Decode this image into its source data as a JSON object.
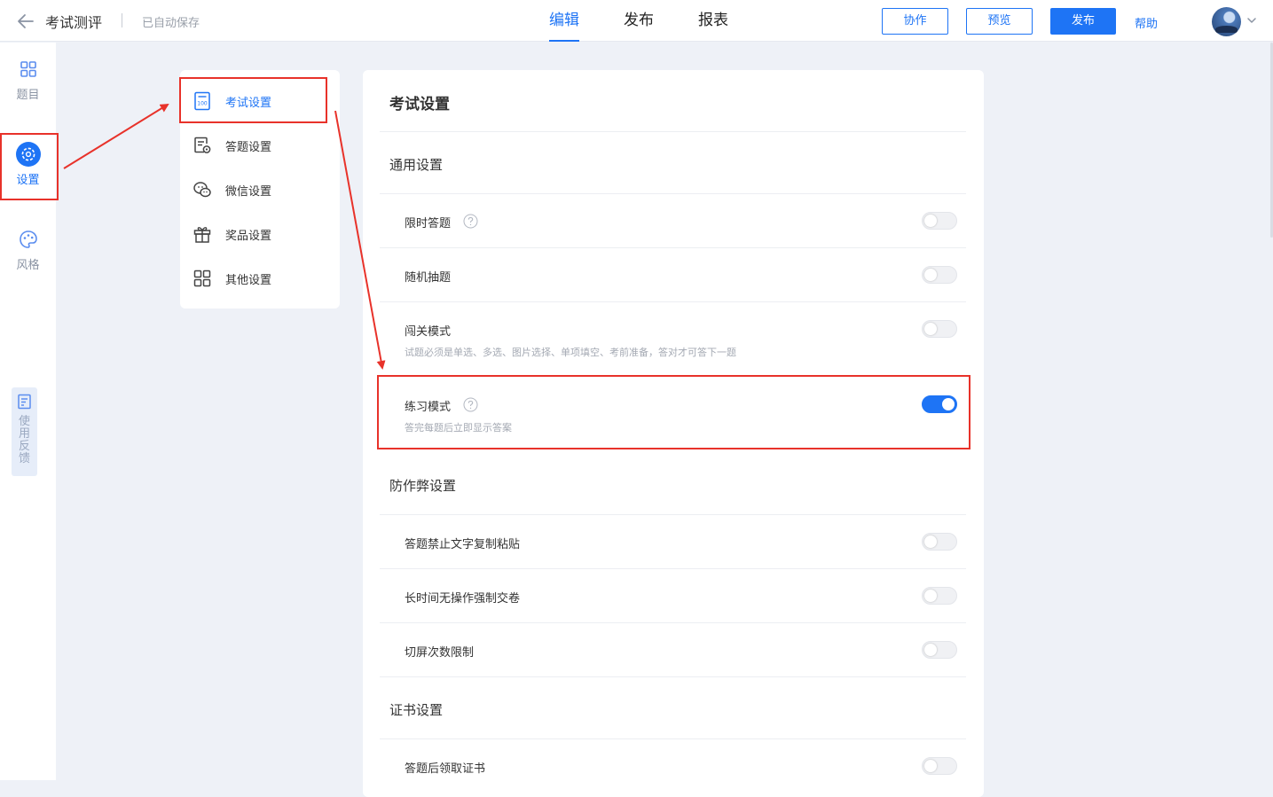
{
  "header": {
    "title": "考试测评",
    "save_status": "已自动保存",
    "tabs": [
      {
        "label": "编辑",
        "active": true
      },
      {
        "label": "发布",
        "active": false
      },
      {
        "label": "报表",
        "active": false
      }
    ],
    "collaborate_label": "协作",
    "preview_label": "预览",
    "publish_label": "发布",
    "help_label": "帮助"
  },
  "sidebar": {
    "items": [
      {
        "label": "题目",
        "icon": "grid-icon",
        "active": false
      },
      {
        "label": "设置",
        "icon": "gear-icon",
        "active": true
      },
      {
        "label": "风格",
        "icon": "palette-icon",
        "active": false
      }
    ],
    "feedback_label": "使用反馈"
  },
  "submenu": {
    "items": [
      {
        "label": "考试设置",
        "icon": "exam-sheet-icon",
        "active": true
      },
      {
        "label": "答题设置",
        "icon": "answer-settings-icon",
        "active": false
      },
      {
        "label": "微信设置",
        "icon": "wechat-icon",
        "active": false
      },
      {
        "label": "奖品设置",
        "icon": "gift-icon",
        "active": false
      },
      {
        "label": "其他设置",
        "icon": "apps-icon",
        "active": false
      }
    ]
  },
  "panel": {
    "title": "考试设置",
    "general": {
      "title": "通用设置",
      "timed_answer": {
        "label": "限时答题",
        "on": false
      },
      "random_questions": {
        "label": "随机抽题",
        "on": false
      },
      "level_mode": {
        "label": "闯关模式",
        "desc": "试题必须是单选、多选、图片选择、单项填空、考前准备，答对才可答下一题",
        "on": false
      },
      "practice_mode": {
        "label": "练习模式",
        "desc": "答完每题后立即显示答案",
        "on": true
      }
    },
    "anti_cheat": {
      "title": "防作弊设置",
      "no_copy_paste": {
        "label": "答题禁止文字复制粘贴",
        "on": false
      },
      "idle_submit": {
        "label": "长时间无操作强制交卷",
        "on": false
      },
      "switch_limit": {
        "label": "切屏次数限制",
        "on": false
      }
    },
    "certificate": {
      "title": "证书设置",
      "claim_after": {
        "label": "答题后领取证书",
        "on": false
      }
    }
  },
  "colors": {
    "accent": "#1e74f5",
    "annotation": "#e8322a",
    "background": "#eef1f7"
  }
}
